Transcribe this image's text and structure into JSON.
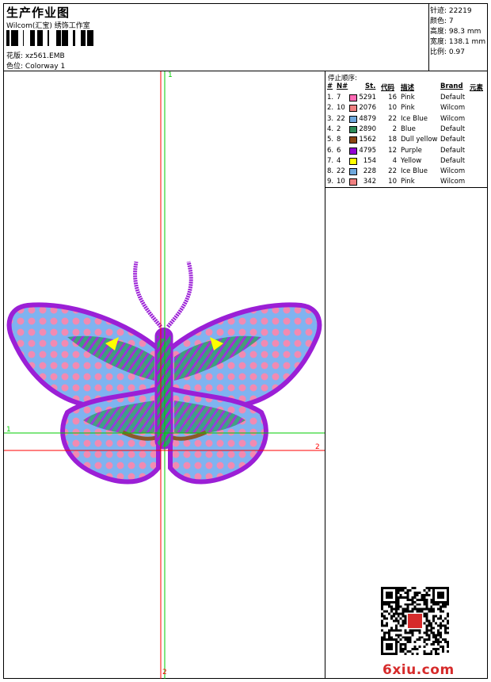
{
  "header": {
    "title": "生产作业图",
    "subtitle": "Wilcom(汇宝) 绣饰工作室",
    "design_label": "花版:",
    "design_value": "xz561.EMB",
    "colorway_label": "色位:",
    "colorway_value": "Colorway 1"
  },
  "stats": {
    "stitches_label": "针迹:",
    "stitches_value": "22219",
    "colors_label": "颜色:",
    "colors_value": "7",
    "height_label": "高度:",
    "height_value": "98.3 mm",
    "width_label": "宽度:",
    "width_value": "138.1 mm",
    "scale_label": "比例:",
    "scale_value": "0.97"
  },
  "table": {
    "title": "停止顺序:",
    "headers": {
      "idx": "#",
      "num": "N#",
      "st": "St.",
      "code": "代码",
      "desc": "描述",
      "brand": "Brand",
      "element": "元素"
    },
    "rows": [
      {
        "idx": "1.",
        "num": "7",
        "color": "#ff69b4",
        "st": "5291",
        "code": "16",
        "desc": "Pink",
        "brand": "Default"
      },
      {
        "idx": "2.",
        "num": "10",
        "color": "#f08080",
        "st": "2076",
        "code": "10",
        "desc": "Pink",
        "brand": "Wilcom"
      },
      {
        "idx": "3.",
        "num": "22",
        "color": "#6fa8dc",
        "st": "4879",
        "code": "22",
        "desc": "Ice Blue",
        "brand": "Wilcom"
      },
      {
        "idx": "4.",
        "num": "2",
        "color": "#2e8b57",
        "st": "2890",
        "code": "2",
        "desc": "Blue",
        "brand": "Default"
      },
      {
        "idx": "5.",
        "num": "8",
        "color": "#8b4513",
        "st": "1562",
        "code": "18",
        "desc": "Dull yellow",
        "brand": "Default"
      },
      {
        "idx": "6.",
        "num": "6",
        "color": "#9400d3",
        "st": "4795",
        "code": "12",
        "desc": "Purple",
        "brand": "Default"
      },
      {
        "idx": "7.",
        "num": "4",
        "color": "#ffff00",
        "st": "154",
        "code": "4",
        "desc": "Yellow",
        "brand": "Default"
      },
      {
        "idx": "8.",
        "num": "22",
        "color": "#6fa8dc",
        "st": "228",
        "code": "22",
        "desc": "Ice Blue",
        "brand": "Wilcom"
      },
      {
        "idx": "9.",
        "num": "10",
        "color": "#f08080",
        "st": "342",
        "code": "10",
        "desc": "Pink",
        "brand": "Wilcom"
      }
    ]
  },
  "axes": {
    "v_top": "1",
    "h_left": "1",
    "h_right": "2",
    "v_bottom": "2"
  },
  "logo": "6xiu.com",
  "colors": {
    "green_axis": "#00cc00",
    "red_axis": "#ff0000",
    "outline": "#9b1fd6",
    "pink": "#f28ab2",
    "blue": "#7fb3f0",
    "green": "#2e9e6a",
    "brown": "#8b5a2b",
    "yellow": "#ffff00"
  }
}
